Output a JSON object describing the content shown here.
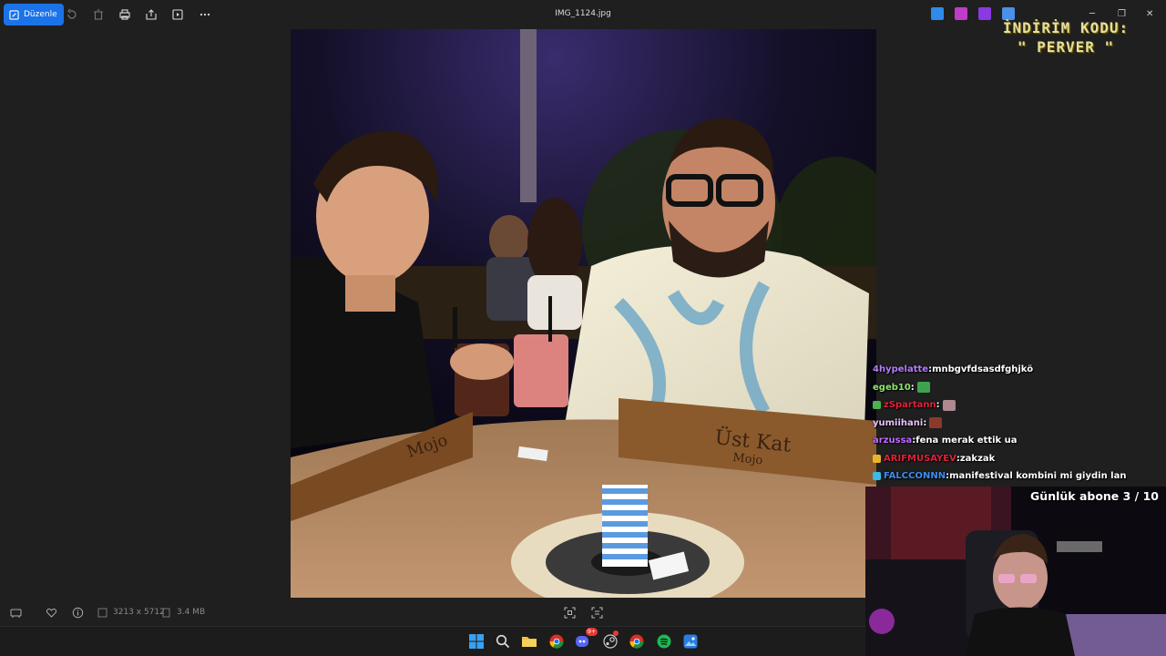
{
  "toolbar": {
    "edit_label": "Düzenle",
    "file_name": "IMG_1124.jpg",
    "icons": [
      "rotate-icon",
      "delete-icon",
      "print-icon",
      "share-icon",
      "slideshow-icon",
      "more-icon"
    ]
  },
  "promo": {
    "line1": "İNDİRİM KODU:",
    "line2": "\" PERVER \""
  },
  "photo": {
    "sign_left": "Mojo",
    "sign_right_1": "Üst Kat",
    "sign_right_2": "Mojo"
  },
  "chat": {
    "messages": [
      {
        "user": "4hypelatte",
        "text": "mnbgvfdsasdfghjkö",
        "color": "#b57cff",
        "badge": "",
        "emote": ""
      },
      {
        "user": "egeb10",
        "text": "",
        "color": "#8be86b",
        "badge": "",
        "emote": "#3fa34d"
      },
      {
        "user": "zSpartann",
        "text": "",
        "color": "#e0223a",
        "badge": "#4caf50",
        "emote": "#b08890"
      },
      {
        "user": "yumiihani",
        "text": "",
        "color": "#e8c2ff",
        "badge": "",
        "emote": "#8a3a2a"
      },
      {
        "user": "arzussa",
        "text": "fena merak ettik ua",
        "color": "#c06bff",
        "badge": "",
        "emote": ""
      },
      {
        "user": "ARIFMUSAYEV",
        "text": "zakzak",
        "color": "#e0223a",
        "badge": "#e8b52a",
        "emote": ""
      },
      {
        "user": "FALCCONNN",
        "text": "manifestival kombini mi giydin lan",
        "color": "#3d8ef0",
        "badge": "#3db8e8",
        "emote": ""
      }
    ]
  },
  "webcam": {
    "sub_goal": "Günlük abone 3 / 10"
  },
  "info": {
    "dimensions": "3213 x 5712",
    "file_size": "3.4 MB"
  },
  "taskbar": {
    "apps": [
      "windows-start-icon",
      "search-icon",
      "file-explorer-icon",
      "chrome-icon",
      "discord-icon",
      "steam-icon",
      "chrome-icon",
      "spotify-icon",
      "photos-icon"
    ],
    "discord_badge": "9+"
  }
}
